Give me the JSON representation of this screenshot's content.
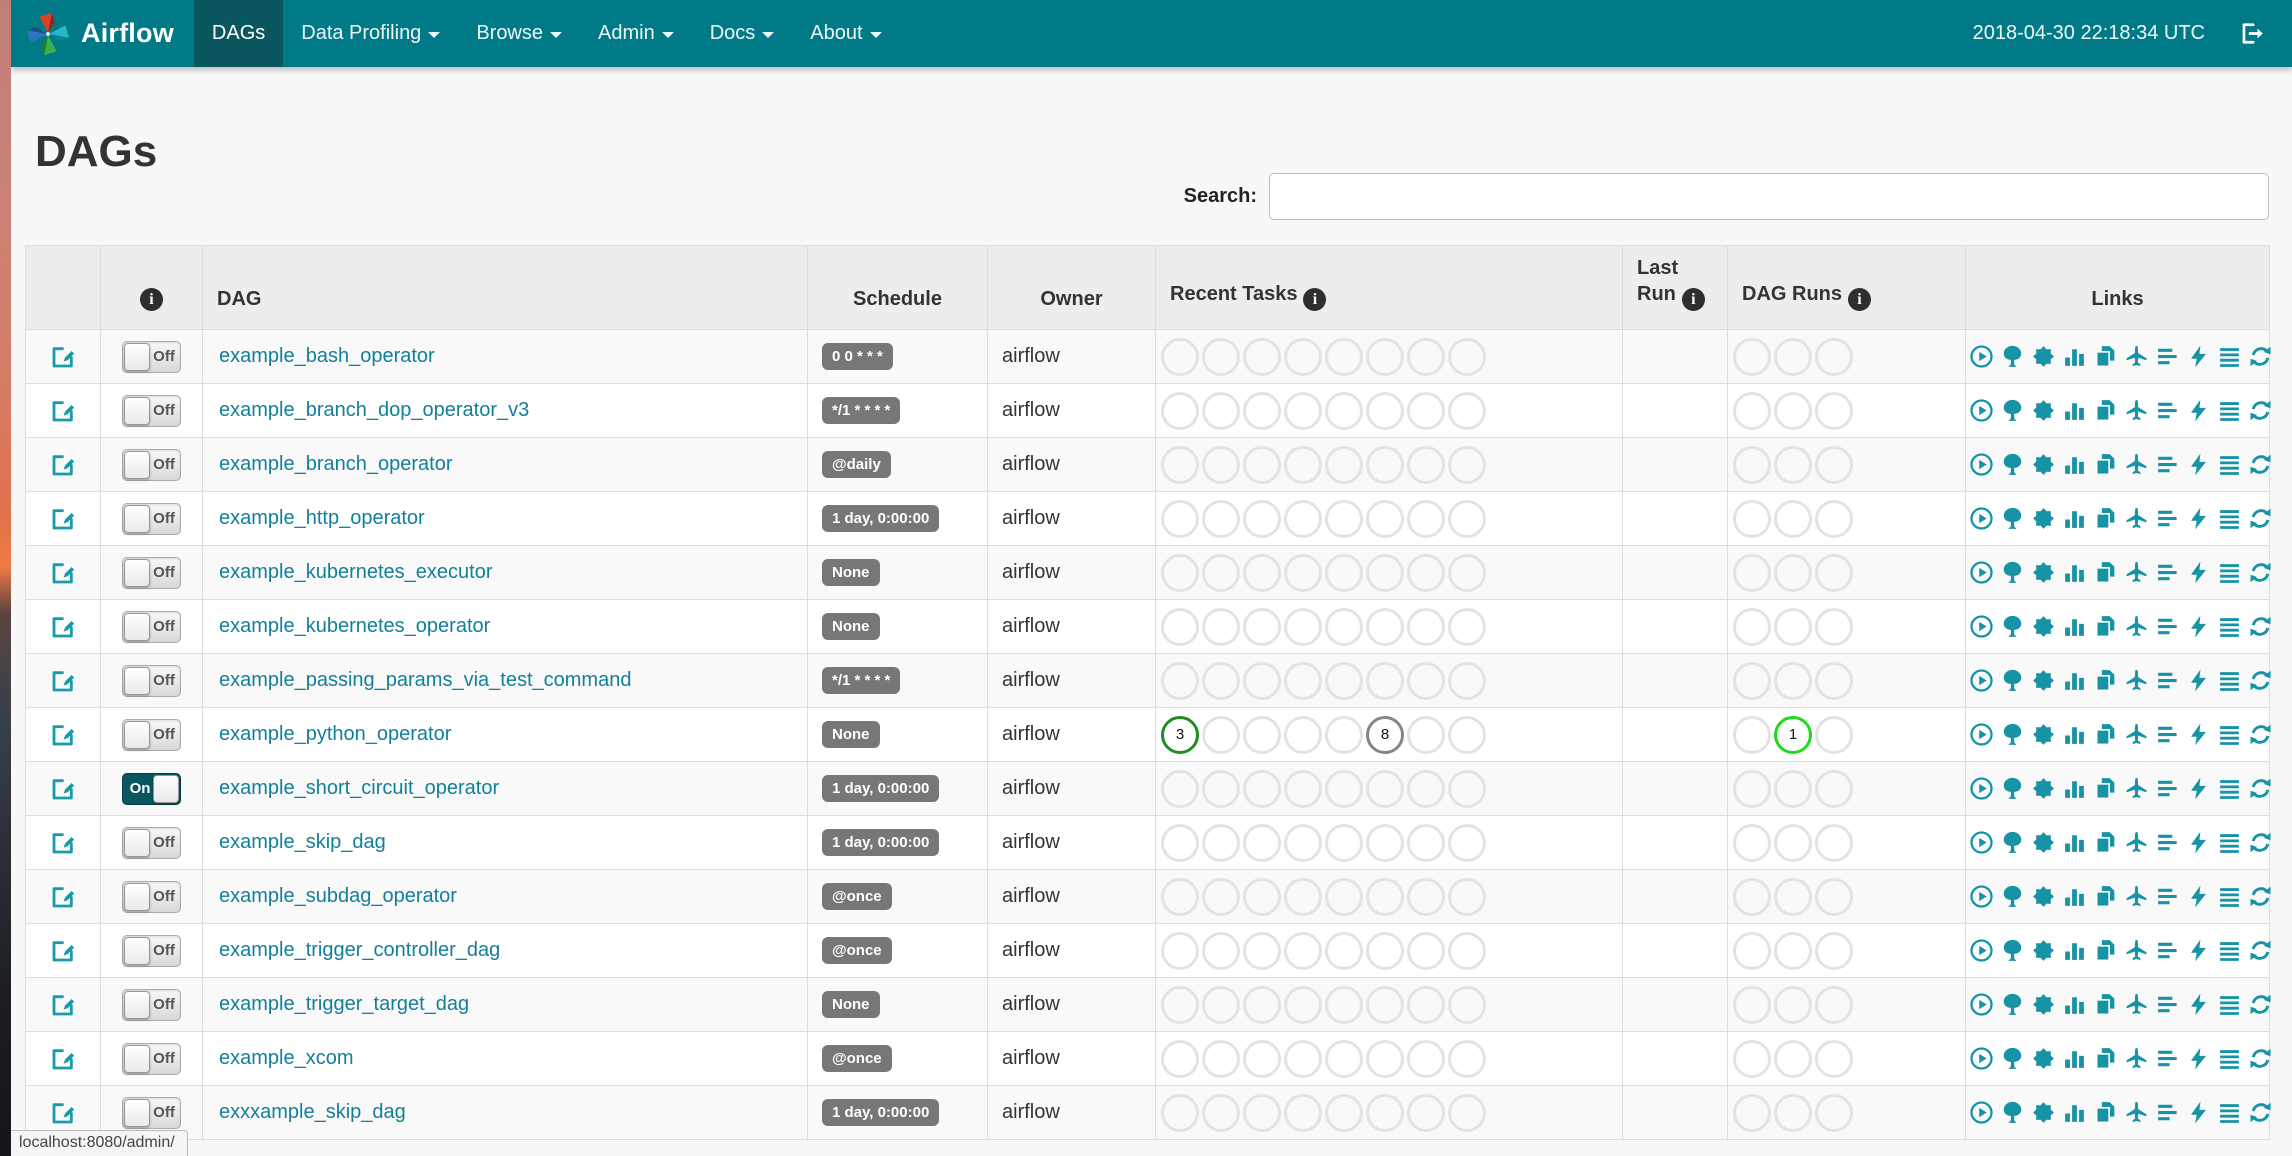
{
  "navbar": {
    "brand": "Airflow",
    "items": [
      {
        "label": "DAGs",
        "active": true,
        "caret": false
      },
      {
        "label": "Data Profiling",
        "active": false,
        "caret": true
      },
      {
        "label": "Browse",
        "active": false,
        "caret": true
      },
      {
        "label": "Admin",
        "active": false,
        "caret": true
      },
      {
        "label": "Docs",
        "active": false,
        "caret": true
      },
      {
        "label": "About",
        "active": false,
        "caret": true
      }
    ],
    "clock": "2018-04-30 22:18:34 UTC",
    "logout_icon": "sign-out-icon"
  },
  "page": {
    "title": "DAGs"
  },
  "search": {
    "label": "Search:",
    "value": "",
    "placeholder": ""
  },
  "table": {
    "headers": {
      "info_glyph": "i",
      "dag": "DAG",
      "schedule": "Schedule",
      "owner": "Owner",
      "recent_tasks": "Recent Tasks",
      "last_run_line1": "Last",
      "last_run_line2": "Run",
      "dag_runs": "DAG Runs",
      "links": "Links"
    },
    "recent_task_slots": 8,
    "dag_run_slots": 3,
    "links_icons": [
      "trigger-dag-icon",
      "tree-view-icon",
      "graph-view-icon",
      "task-duration-icon",
      "task-tries-icon",
      "landing-times-icon",
      "gantt-icon",
      "code-icon",
      "log-icon",
      "refresh-icon"
    ],
    "rows": [
      {
        "toggle": "Off",
        "name": "example_bash_operator",
        "schedule": "0 0 * * *",
        "owner": "airflow",
        "recent_tasks": [],
        "dag_runs": []
      },
      {
        "toggle": "Off",
        "name": "example_branch_dop_operator_v3",
        "schedule": "*/1 * * * *",
        "owner": "airflow",
        "recent_tasks": [],
        "dag_runs": []
      },
      {
        "toggle": "Off",
        "name": "example_branch_operator",
        "schedule": "@daily",
        "owner": "airflow",
        "recent_tasks": [],
        "dag_runs": []
      },
      {
        "toggle": "Off",
        "name": "example_http_operator",
        "schedule": "1 day, 0:00:00",
        "owner": "airflow",
        "recent_tasks": [],
        "dag_runs": []
      },
      {
        "toggle": "Off",
        "name": "example_kubernetes_executor",
        "schedule": "None",
        "owner": "airflow",
        "recent_tasks": [],
        "dag_runs": []
      },
      {
        "toggle": "Off",
        "name": "example_kubernetes_operator",
        "schedule": "None",
        "owner": "airflow",
        "recent_tasks": [],
        "dag_runs": []
      },
      {
        "toggle": "Off",
        "name": "example_passing_params_via_test_command",
        "schedule": "*/1 * * * *",
        "owner": "airflow",
        "recent_tasks": [],
        "dag_runs": []
      },
      {
        "toggle": "Off",
        "name": "example_python_operator",
        "schedule": "None",
        "owner": "airflow",
        "recent_tasks": [
          {
            "slot": 0,
            "count": "3",
            "color": "#228b22"
          },
          {
            "slot": 5,
            "count": "8",
            "color": "#858585"
          }
        ],
        "dag_runs": [
          {
            "slot": 1,
            "count": "1",
            "color": "#1ddb1d"
          }
        ]
      },
      {
        "toggle": "On",
        "name": "example_short_circuit_operator",
        "schedule": "1 day, 0:00:00",
        "owner": "airflow",
        "recent_tasks": [],
        "dag_runs": []
      },
      {
        "toggle": "Off",
        "name": "example_skip_dag",
        "schedule": "1 day, 0:00:00",
        "owner": "airflow",
        "recent_tasks": [],
        "dag_runs": []
      },
      {
        "toggle": "Off",
        "name": "example_subdag_operator",
        "schedule": "@once",
        "owner": "airflow",
        "recent_tasks": [],
        "dag_runs": []
      },
      {
        "toggle": "Off",
        "name": "example_trigger_controller_dag",
        "schedule": "@once",
        "owner": "airflow",
        "recent_tasks": [],
        "dag_runs": []
      },
      {
        "toggle": "Off",
        "name": "example_trigger_target_dag",
        "schedule": "None",
        "owner": "airflow",
        "recent_tasks": [],
        "dag_runs": []
      },
      {
        "toggle": "Off",
        "name": "example_xcom",
        "schedule": "@once",
        "owner": "airflow",
        "recent_tasks": [],
        "dag_runs": []
      },
      {
        "toggle": "Off",
        "name": "exxxample_skip_dag",
        "schedule": "1 day, 0:00:00",
        "owner": "airflow",
        "recent_tasks": [],
        "dag_runs": []
      }
    ]
  },
  "status_bar": {
    "text": "localhost:8080/admin/"
  },
  "colors": {
    "navbar_bg": "#007a87",
    "navbar_active_bg": "#0a565e",
    "link_teal": "#12809a",
    "icon_teal": "#1793a6",
    "badge_bg": "#777777",
    "header_bg": "#ededed",
    "stripe": "#f9f9f9",
    "border": "#dddddd",
    "circle_empty": "#e3e3e3",
    "task_success_green": "#228b22",
    "task_gray": "#858585",
    "dagrun_running_lime": "#1ddb1d",
    "toggle_on_bg": "#0a5660"
  }
}
